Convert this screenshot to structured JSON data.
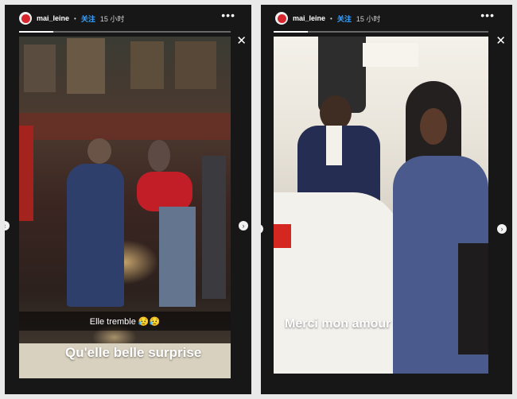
{
  "stories": [
    {
      "username": "mai_leine",
      "separator": "•",
      "follow_label": "关注",
      "time_ago": "15 小时",
      "more_icon": "•••",
      "close_icon": "✕",
      "progress": 0.16,
      "caption_bar": "Elle tremble 😥😥",
      "caption_big": "Qu'elle belle surprise",
      "prev_icon": "‹",
      "next_icon": "›"
    },
    {
      "username": "mai_leine",
      "separator": "•",
      "follow_label": "关注",
      "time_ago": "15 小时",
      "more_icon": "•••",
      "close_icon": "✕",
      "progress": 0.16,
      "caption_big": "Merci mon amour",
      "prev_icon": "‹",
      "next_icon": "›"
    }
  ],
  "colors": {
    "follow": "#3aa2ff",
    "avatar_ring": "#d8262f",
    "panel_bg": "#171717",
    "page_bg": "#e9e9e9"
  }
}
